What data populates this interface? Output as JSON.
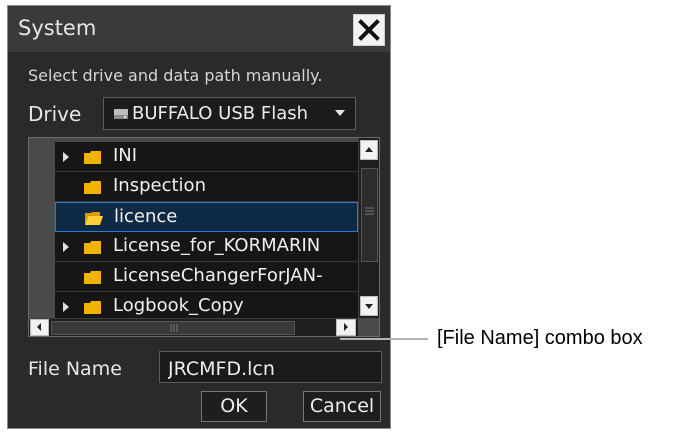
{
  "dialog": {
    "title": "System",
    "instruction": "Select drive and data path manually.",
    "drive_label": "Drive",
    "drive_value": "BUFFALO USB Flash",
    "tree_items": [
      {
        "label": "INI",
        "expandable": true,
        "selected": false
      },
      {
        "label": "Inspection",
        "expandable": false,
        "selected": false
      },
      {
        "label": "licence",
        "expandable": false,
        "selected": true
      },
      {
        "label": "License_for_KORMARIN",
        "expandable": true,
        "selected": false
      },
      {
        "label": "LicenseChangerForJAN-",
        "expandable": false,
        "selected": false
      },
      {
        "label": "Logbook_Copy",
        "expandable": true,
        "selected": false
      }
    ],
    "filename_label": "File Name",
    "filename_value": "JRCMFD.lcn",
    "ok_label": "OK",
    "cancel_label": "Cancel"
  },
  "callout": {
    "text": "[File Name] combo box"
  },
  "colors": {
    "folder": "#f0b400",
    "folder_open": "#ffcf3a",
    "selection_border": "#2b7bd2"
  },
  "icons": [
    "close-icon",
    "drive-icon",
    "chevron-down-icon",
    "expand-arrow-icon",
    "folder-icon",
    "folder-open-icon",
    "scroll-up-icon",
    "scroll-down-icon",
    "scroll-left-icon",
    "scroll-right-icon"
  ]
}
